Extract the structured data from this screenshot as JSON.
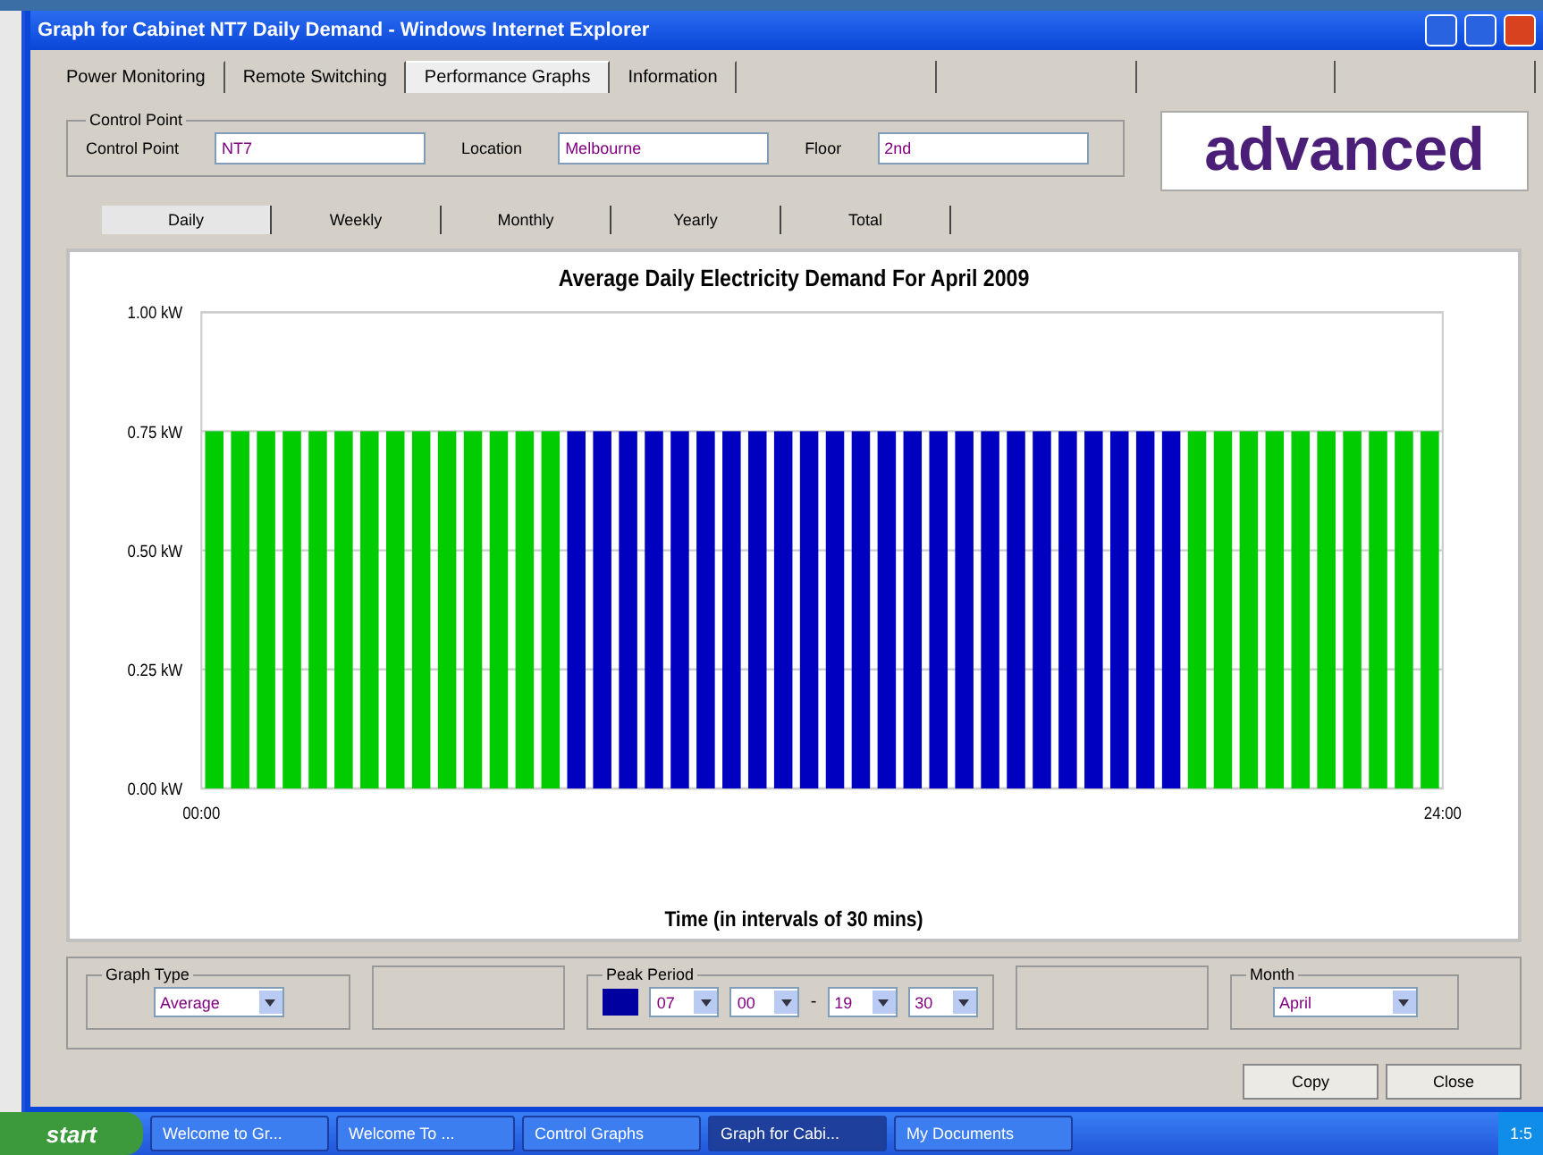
{
  "window": {
    "title": "Graph for Cabinet NT7 Daily Demand - Windows Internet Explorer"
  },
  "tabs": [
    {
      "label": "Power Monitoring",
      "selected": false
    },
    {
      "label": "Remote Switching",
      "selected": false
    },
    {
      "label": "Performance Graphs",
      "selected": true
    },
    {
      "label": "Information",
      "selected": false
    }
  ],
  "control_point": {
    "legend": "Control Point",
    "fields": [
      {
        "label": "Control Point",
        "value": "NT7"
      },
      {
        "label": "Location",
        "value": "Melbourne"
      },
      {
        "label": "Floor",
        "value": "2nd"
      }
    ]
  },
  "logo": "advanced",
  "period_tabs": [
    {
      "label": "Daily",
      "selected": true
    },
    {
      "label": "Weekly",
      "selected": false
    },
    {
      "label": "Monthly",
      "selected": false
    },
    {
      "label": "Yearly",
      "selected": false
    },
    {
      "label": "Total",
      "selected": false
    }
  ],
  "chart": {
    "chart_data": {
      "type": "bar",
      "title": "Average Daily Electricity Demand For April 2009",
      "xlabel": "Time (in intervals of 30 mins)",
      "x": [
        0,
        0.5,
        1,
        1.5,
        2,
        2.5,
        3,
        3.5,
        4,
        4.5,
        5,
        5.5,
        6,
        6.5,
        7,
        7.5,
        8,
        8.5,
        9,
        9.5,
        10,
        10.5,
        11,
        11.5,
        12,
        12.5,
        13,
        13.5,
        14,
        14.5,
        15,
        15.5,
        16,
        16.5,
        17,
        17.5,
        18,
        18.5,
        19,
        19.5,
        20,
        20.5,
        21,
        21.5,
        22,
        22.5,
        23,
        23.5
      ],
      "xlim": [
        0,
        24
      ],
      "xticks": [
        {
          "value": 0,
          "label": "00:00"
        },
        {
          "value": 24,
          "label": "24:00"
        }
      ],
      "ylim": [
        0,
        1
      ],
      "grid": true,
      "yticks": [
        {
          "value": 0,
          "label": "0.00 kW"
        },
        {
          "value": 0.25,
          "label": "0.25 kW"
        },
        {
          "value": 0.5,
          "label": "0.50 kW"
        },
        {
          "value": 0.75,
          "label": "0.75 kW"
        },
        {
          "value": 1,
          "label": "1.00 kW"
        }
      ],
      "series": [
        {
          "color": "#00cc00",
          "values": [
            0.75,
            0.75,
            0.75,
            0.75,
            0.75,
            0.75,
            0.75,
            0.75,
            0.75,
            0.75,
            0.75,
            0.75,
            0.75,
            0.75,
            null,
            null,
            null,
            null,
            null,
            null,
            null,
            null,
            null,
            null,
            null,
            null,
            null,
            null,
            null,
            null,
            null,
            null,
            null,
            null,
            null,
            null,
            null,
            null,
            0.75,
            0.75,
            0.75,
            0.75,
            0.75,
            0.75,
            0.75,
            0.75,
            0.75,
            0.75
          ]
        },
        {
          "color": "#0000c0",
          "values": [
            null,
            null,
            null,
            null,
            null,
            null,
            null,
            null,
            null,
            null,
            null,
            null,
            null,
            null,
            0.75,
            0.75,
            0.75,
            0.75,
            0.75,
            0.75,
            0.75,
            0.75,
            0.75,
            0.75,
            0.75,
            0.75,
            0.75,
            0.75,
            0.75,
            0.75,
            0.75,
            0.75,
            0.75,
            0.75,
            0.75,
            0.75,
            0.75,
            0.75,
            null,
            null,
            null,
            null,
            null,
            null,
            null,
            null,
            null,
            null
          ]
        }
      ]
    }
  },
  "options": {
    "graph_type": {
      "legend": "Graph Type",
      "value": "Average"
    },
    "peak_period": {
      "legend": "Peak Period",
      "color": "#0000a0",
      "start_hour": "07",
      "start_minute": "00",
      "separator": "-",
      "end_hour": "19",
      "end_minute": "30"
    },
    "month": {
      "legend": "Month",
      "value": "April"
    }
  },
  "buttons": [
    "Copy",
    "Close"
  ],
  "taskbar": {
    "start": "start",
    "tasks": [
      {
        "label": "Welcome to Gr...",
        "selected": false
      },
      {
        "label": "Welcome To ...",
        "selected": false
      },
      {
        "label": "Control Graphs",
        "selected": false
      },
      {
        "label": "Graph for Cabi...",
        "selected": true
      },
      {
        "label": "My Documents",
        "selected": false
      }
    ],
    "clock": "1:5"
  }
}
